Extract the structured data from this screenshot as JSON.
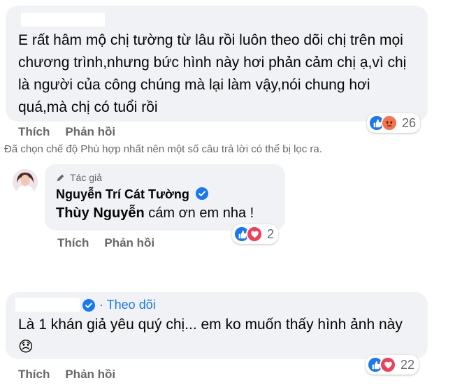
{
  "comments": [
    {
      "text": "E rất hâm mộ chị tường từ lâu rồi luôn theo dõi chị trên mọi chương trình,nhưng bức hình này hơi phản cảm chị ạ,vì chị là người của công chúng mà lại làm vậy,nói chung hơi quá,mà chị có tuổi rồi",
      "like_label": "Thích",
      "reply_label": "Phản hồi",
      "reaction_count": "26",
      "reactions": [
        "like-icon",
        "angry-icon"
      ]
    },
    {
      "author_badge": "Tác giả",
      "author": "Nguyễn Trí Cát Tường",
      "mention": "Thùy Nguyễn",
      "text": " cám ơn em nha !",
      "like_label": "Thích",
      "reply_label": "Phản hồi",
      "reaction_count": "2",
      "reactions": [
        "like-icon",
        "love-icon"
      ]
    },
    {
      "follow_label": "· Theo dõi",
      "text": "Là 1 khán giả yêu quý chị... em ko muốn thấy hình ảnh này 😞",
      "like_label": "Thích",
      "reply_label": "Phản hồi",
      "reaction_count": "22",
      "reactions": [
        "like-icon",
        "love-icon"
      ]
    }
  ],
  "filter_notice": "Đã chọn chế độ Phù hợp nhất nên một số câu trả lời có thể bị lọc ra.",
  "colors": {
    "bubble": "#f0f2f5",
    "secondary_text": "#65676b",
    "like_blue": "#1877f2",
    "love_red": "#f33e58",
    "angry_orange": "#f7714c"
  }
}
